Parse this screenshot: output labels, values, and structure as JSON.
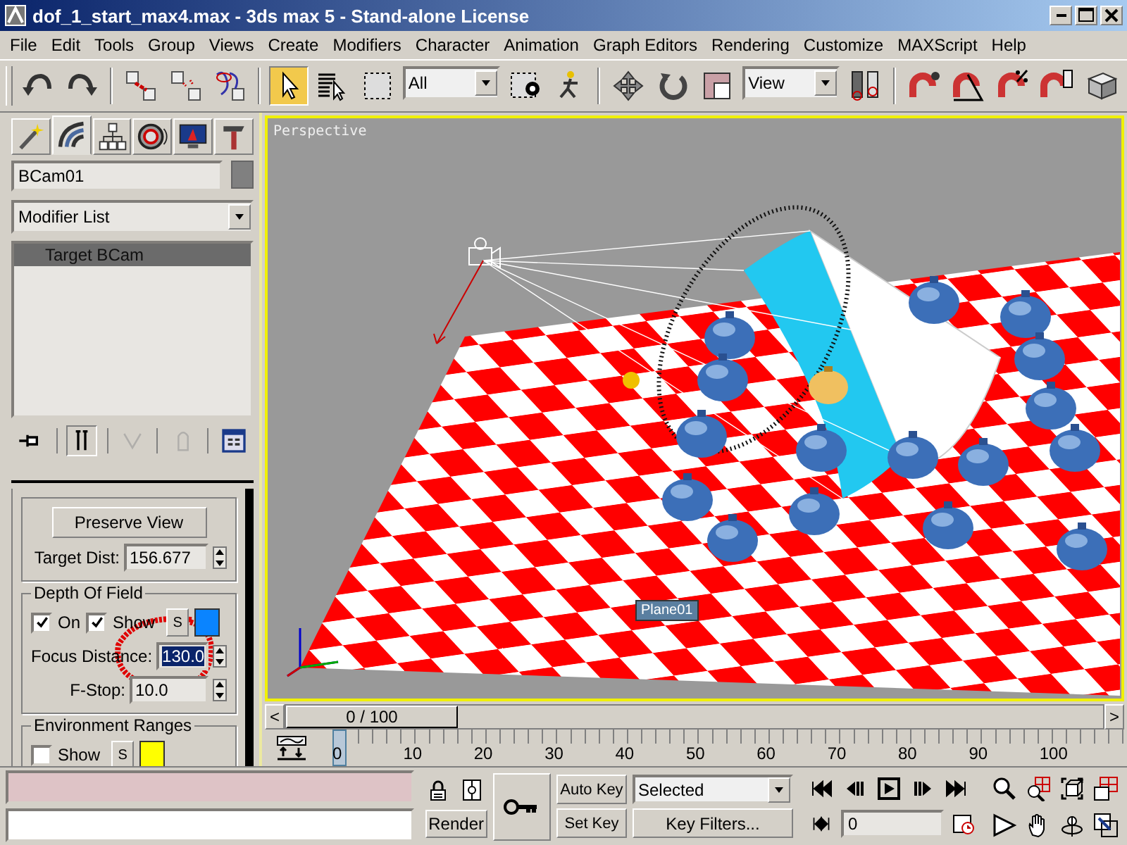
{
  "window": {
    "title": "dof_1_start_max4.max - 3ds max 5 - Stand-alone License"
  },
  "menu": [
    "File",
    "Edit",
    "Tools",
    "Group",
    "Views",
    "Create",
    "Modifiers",
    "Character",
    "Animation",
    "Graph Editors",
    "Rendering",
    "Customize",
    "MAXScript",
    "Help"
  ],
  "toolbar": [
    {
      "kind": "undo",
      "selected": false
    },
    {
      "kind": "redo",
      "selected": false
    },
    {
      "kind": "separator"
    },
    {
      "kind": "link",
      "selected": false
    },
    {
      "kind": "unlink",
      "selected": false
    },
    {
      "kind": "bind",
      "selected": false
    },
    {
      "kind": "separator"
    },
    {
      "kind": "select",
      "selected": true
    },
    {
      "kind": "select-name",
      "selected": false
    },
    {
      "kind": "region",
      "selected": false
    },
    {
      "kind": "dropdown",
      "value": "All"
    },
    {
      "kind": "crossing",
      "selected": false
    },
    {
      "kind": "manipulate",
      "selected": false
    },
    {
      "kind": "separator"
    },
    {
      "kind": "move",
      "selected": false
    },
    {
      "kind": "rotate",
      "selected": false
    },
    {
      "kind": "scale",
      "selected": false
    },
    {
      "kind": "dropdown",
      "value": "View"
    },
    {
      "kind": "pivot",
      "selected": false
    },
    {
      "kind": "separator"
    },
    {
      "kind": "snap",
      "selected": false
    },
    {
      "kind": "angle-snap",
      "selected": false
    },
    {
      "kind": "percent-snap",
      "selected": false
    },
    {
      "kind": "spinner-snap",
      "selected": false
    },
    {
      "kind": "named-sets",
      "selected": false
    }
  ],
  "command_panel": {
    "tabs": [
      {
        "kind": "create",
        "selected": false
      },
      {
        "kind": "modify",
        "selected": true
      },
      {
        "kind": "hierarchy",
        "selected": false
      },
      {
        "kind": "motion",
        "selected": false
      },
      {
        "kind": "display",
        "selected": false
      },
      {
        "kind": "utilities",
        "selected": false
      }
    ],
    "object_name": "BCam01",
    "modifier_list": "Modifier List",
    "stack": [
      {
        "label": "Target BCam",
        "selected": true
      }
    ],
    "stack_tools": [
      {
        "kind": "pin",
        "on": false,
        "disabled": false
      },
      {
        "kind": "show-end",
        "on": true,
        "disabled": false
      },
      {
        "kind": "unique",
        "on": false,
        "disabled": true
      },
      {
        "kind": "remove",
        "on": false,
        "disabled": true
      },
      {
        "kind": "configure",
        "on": false,
        "disabled": false
      }
    ],
    "parameters": {
      "preserve_button": "Preserve View",
      "target_dist": {
        "label": "Target Dist:",
        "value": "156.677"
      },
      "depth_of_field": {
        "title": "Depth Of Field",
        "on": {
          "label": "On",
          "checked": true
        },
        "show": {
          "label": "Show",
          "checked": true
        },
        "swatch_button": "S",
        "focus_distance": {
          "label": "Focus Distance:",
          "value": "130.0",
          "selected": true
        },
        "f_stop": {
          "label": "F-Stop:",
          "value": "10.0",
          "selected": false
        }
      },
      "environment_ranges": {
        "title": "Environment Ranges",
        "show": {
          "label": "Show",
          "checked": false
        },
        "swatch_button": "S"
      }
    }
  },
  "viewport": {
    "label": "Perspective",
    "object_tooltip": "Plane01"
  },
  "time_slider": {
    "prev": "<",
    "position": "0 / 100",
    "next": ">"
  },
  "track_bar": {
    "labels": [
      "0",
      "10",
      "20",
      "30",
      "40",
      "50",
      "60",
      "70",
      "80",
      "90",
      "100"
    ]
  },
  "animation_controls": {
    "render_button": "Render",
    "auto_key": {
      "label": "Auto Key",
      "on": false
    },
    "set_key": "Set Key",
    "key_mode": "Selected",
    "key_filters": "Key Filters...",
    "frame": "0"
  }
}
